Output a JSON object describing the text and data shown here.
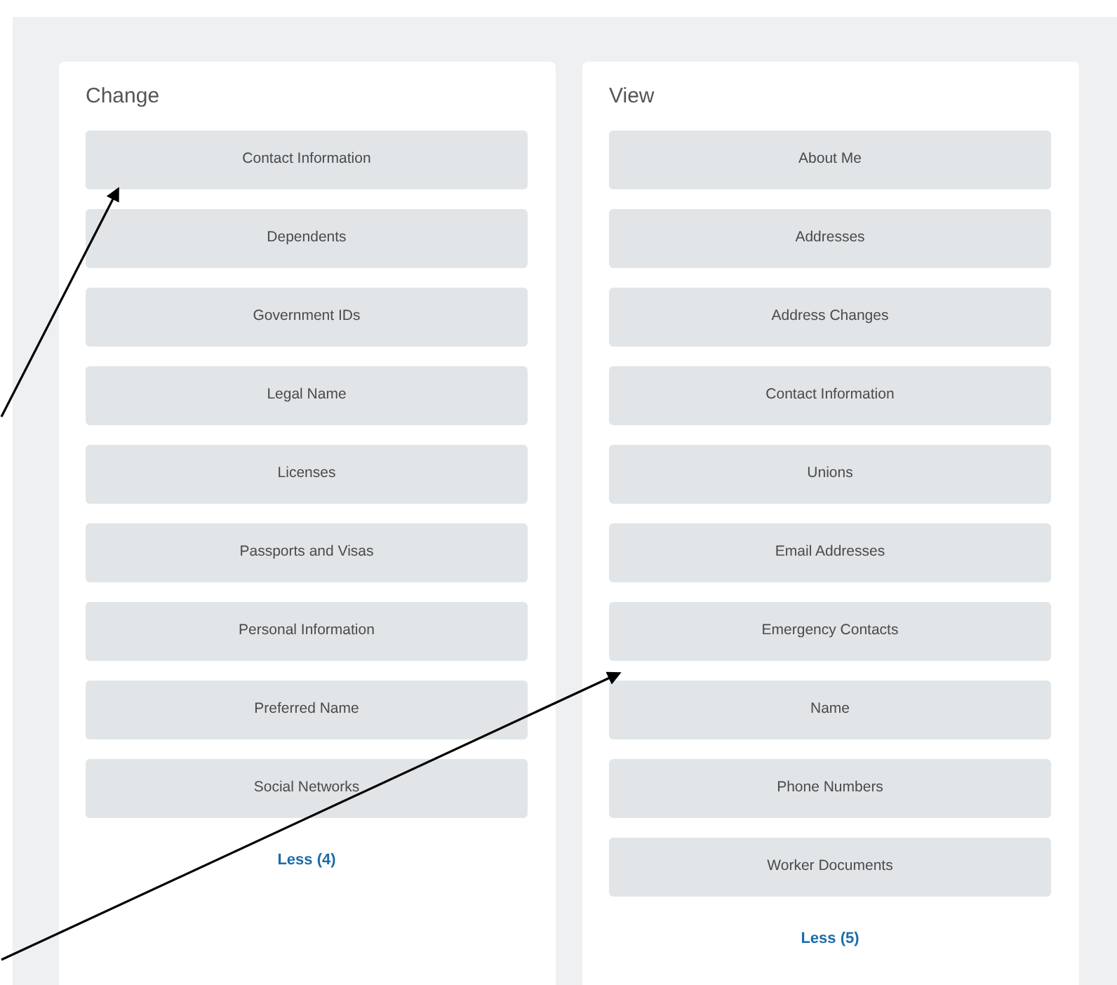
{
  "panels": [
    {
      "heading": "Change",
      "items": [
        "Contact Information",
        "Dependents",
        "Government IDs",
        "Legal Name",
        "Licenses",
        "Passports and Visas",
        "Personal Information",
        "Preferred Name",
        "Social Networks"
      ],
      "toggle": "Less (4)"
    },
    {
      "heading": "View",
      "items": [
        "About Me",
        "Addresses",
        "Address Changes",
        "Contact Information",
        "Unions",
        "Email Addresses",
        "Emergency Contacts",
        "Name",
        "Phone Numbers",
        "Worker Documents"
      ],
      "toggle": "Less (5)"
    }
  ]
}
